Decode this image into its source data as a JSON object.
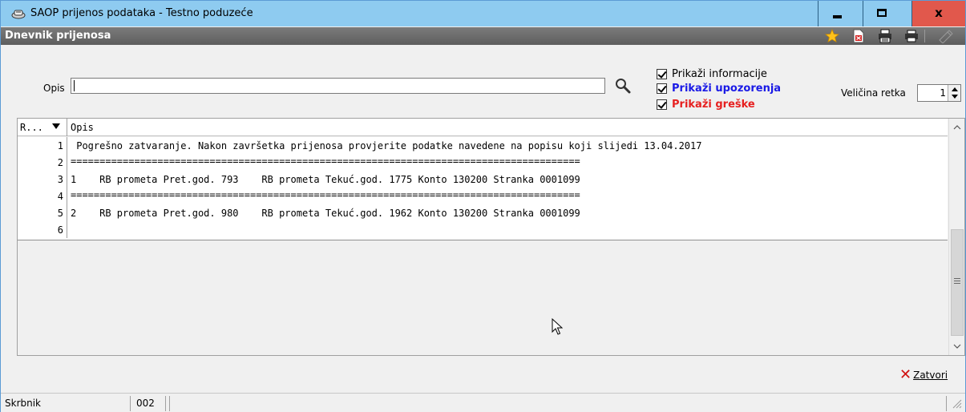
{
  "window": {
    "title": "SAOP prijenos podataka - Testno poduzeće",
    "app_icon": "transfer-icon",
    "controls": [
      "minimize-icon",
      "maximize-icon",
      "close-icon"
    ],
    "close_glyph": "x"
  },
  "section": {
    "title": "Dnevnik prijenosa",
    "toolbar_icons": [
      "star-icon",
      "export-excel-icon",
      "printer-stack-icon",
      "printer-icon",
      "edit-disabled-icon"
    ]
  },
  "filters": {
    "opis_label": "Opis",
    "opis_value": "",
    "search_icon": "magnifier-icon",
    "checkboxes": [
      {
        "label": "Prikaži informacije",
        "checked": true
      },
      {
        "label": "Prikaži upozorenja",
        "checked": true
      },
      {
        "label": "Prikaži greške",
        "checked": true
      }
    ],
    "row_size_label": "Veličina retka",
    "row_size_value": "1"
  },
  "grid": {
    "columns": [
      "R...",
      "Opis"
    ],
    "rows": [
      {
        "n": "1",
        "text": " Pogrešno zatvaranje. Nakon završetka prijenosa provjerite podatke navedene na popisu koji slijedi 13.04.2017"
      },
      {
        "n": "2",
        "text": "========================================================================================"
      },
      {
        "n": "3",
        "text": "1    RB prometa Pret.god. 793    RB prometa Tekuć.god. 1775 Konto 130200 Stranka 0001099"
      },
      {
        "n": "4",
        "text": "========================================================================================"
      },
      {
        "n": "5",
        "text": "2    RB prometa Pret.god. 980    RB prometa Tekuć.god. 1962 Konto 130200 Stranka 0001099"
      },
      {
        "n": "6",
        "text": ""
      }
    ]
  },
  "footer": {
    "close_label": "Zatvori",
    "status_user": "Skrbnik",
    "status_code": "002"
  },
  "colors": {
    "titlebar": "#8ecbf0",
    "close_button": "#e1584c",
    "section_header": "#6b6b6b",
    "warning_label": "#1a1ae6",
    "error_label": "#e62020"
  }
}
